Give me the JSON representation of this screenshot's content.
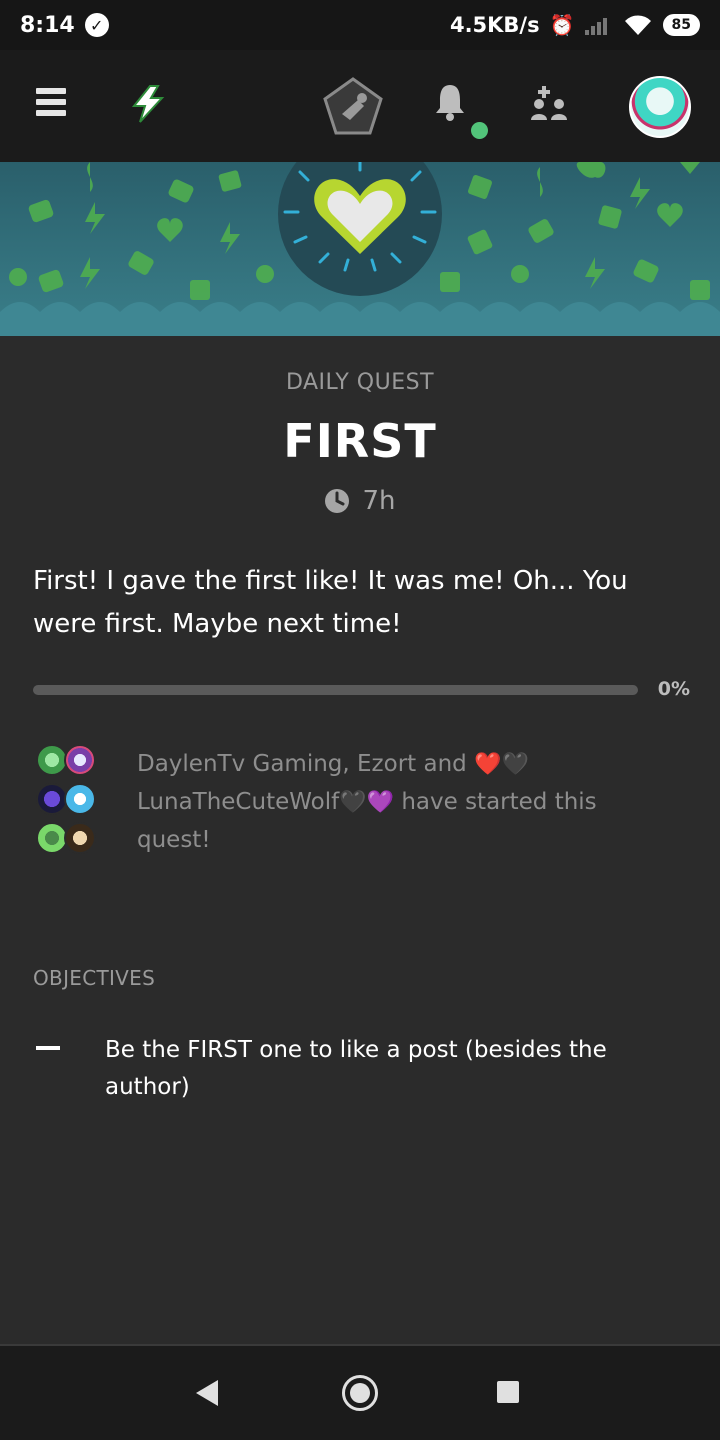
{
  "status_bar": {
    "time": "8:14",
    "network_speed": "4.5KB/s",
    "battery": "85"
  },
  "top_nav": {
    "icons": [
      "menu-icon",
      "bolt-icon",
      "quest-pentagon-icon",
      "bell-icon",
      "add-friend-icon",
      "profile-avatar"
    ]
  },
  "quest": {
    "kicker": "DAILY QUEST",
    "title": "FIRST",
    "time_left": "7h",
    "description": "First! I gave the first like! It was me! Oh... You were first. Maybe next time!",
    "progress_fraction": 0,
    "progress_label": "0%",
    "participants": {
      "text_before": "DaylenTv Gaming, Ezort and ",
      "heart1": "❤️",
      "heart2": "🖤",
      "name2": "LunaTheCuteWolf",
      "heart3": "🖤",
      "heart4": "💜",
      "text_after": " have started this quest!"
    }
  },
  "objectives": {
    "label": "OBJECTIVES",
    "items": [
      {
        "text": "Be the FIRST one to like a post (besides the author)"
      }
    ]
  },
  "colors": {
    "background": "#2b2b2b",
    "nav": "#1b1b1b",
    "banner": "#2f6b77",
    "accent_green": "#7cd35c",
    "online": "#52c47a"
  }
}
